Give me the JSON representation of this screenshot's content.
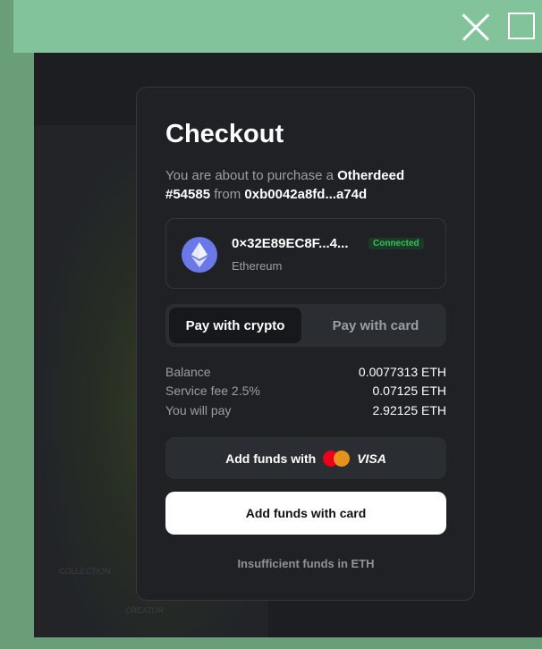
{
  "window": {
    "close_icon": "close-icon",
    "maximize_icon": "maximize-icon"
  },
  "background": {
    "col_left": "COLLECTION",
    "col_right": "CREATOR"
  },
  "checkout": {
    "title": "Checkout",
    "desc_prefix": "You are about to purchase a ",
    "item_name": "Otherdeed #54585",
    "desc_from": " from ",
    "seller": "0xb0042a8fd...a74d",
    "wallet": {
      "address": "0×32E89EC8F...4...",
      "status": "Connected",
      "network": "Ethereum",
      "icon": "ethereum-icon"
    },
    "tabs": {
      "crypto": "Pay with crypto",
      "card": "Pay with card"
    },
    "summary": [
      {
        "label": "Balance",
        "value": "0.0077313 ETH"
      },
      {
        "label": "Service fee 2.5%",
        "value": "0.07125 ETH"
      },
      {
        "label": "You will pay",
        "value": "2.92125 ETH"
      }
    ],
    "add_funds_with": "Add funds with",
    "visa": "VISA",
    "card_button": "Add funds with card",
    "note": "Insufficient funds in ETH"
  },
  "colors": {
    "topbar": "#82c39c",
    "modal": "#1f2125",
    "connected": "#2fc25a"
  }
}
